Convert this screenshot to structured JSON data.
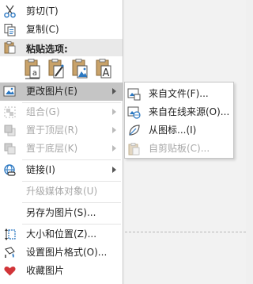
{
  "menu": {
    "cut": "剪切(T)",
    "copy": "复制(C)",
    "paste_options": "粘贴选项:",
    "paste_icons": [
      "keep-text-only-icon",
      "merge-format-icon",
      "paste-as-picture-icon",
      "keep-text-icon"
    ],
    "change_picture": "更改图片(E)",
    "group": "组合(G)",
    "bring_to_front": "置于顶层(R)",
    "send_to_back": "置于底层(K)",
    "link": "链接(I)",
    "upgrade_media": "升级媒体对象(U)",
    "save_as_picture": "另存为图片(S)...",
    "size_position": "大小和位置(Z)...",
    "format_picture": "设置图片格式(O)...",
    "favorite_picture": "收藏图片"
  },
  "submenu": {
    "from_file": "来自文件(F)...",
    "from_online": "来自在线来源(O)...",
    "from_icons": "从图标...(I)",
    "from_clipboard": "自剪贴板(C)..."
  },
  "colors": {
    "highlight": "#c5c5c5",
    "disabled_text": "#a8a8a8",
    "icon_blue": "#2b78c2",
    "heart_red": "#d13438"
  }
}
